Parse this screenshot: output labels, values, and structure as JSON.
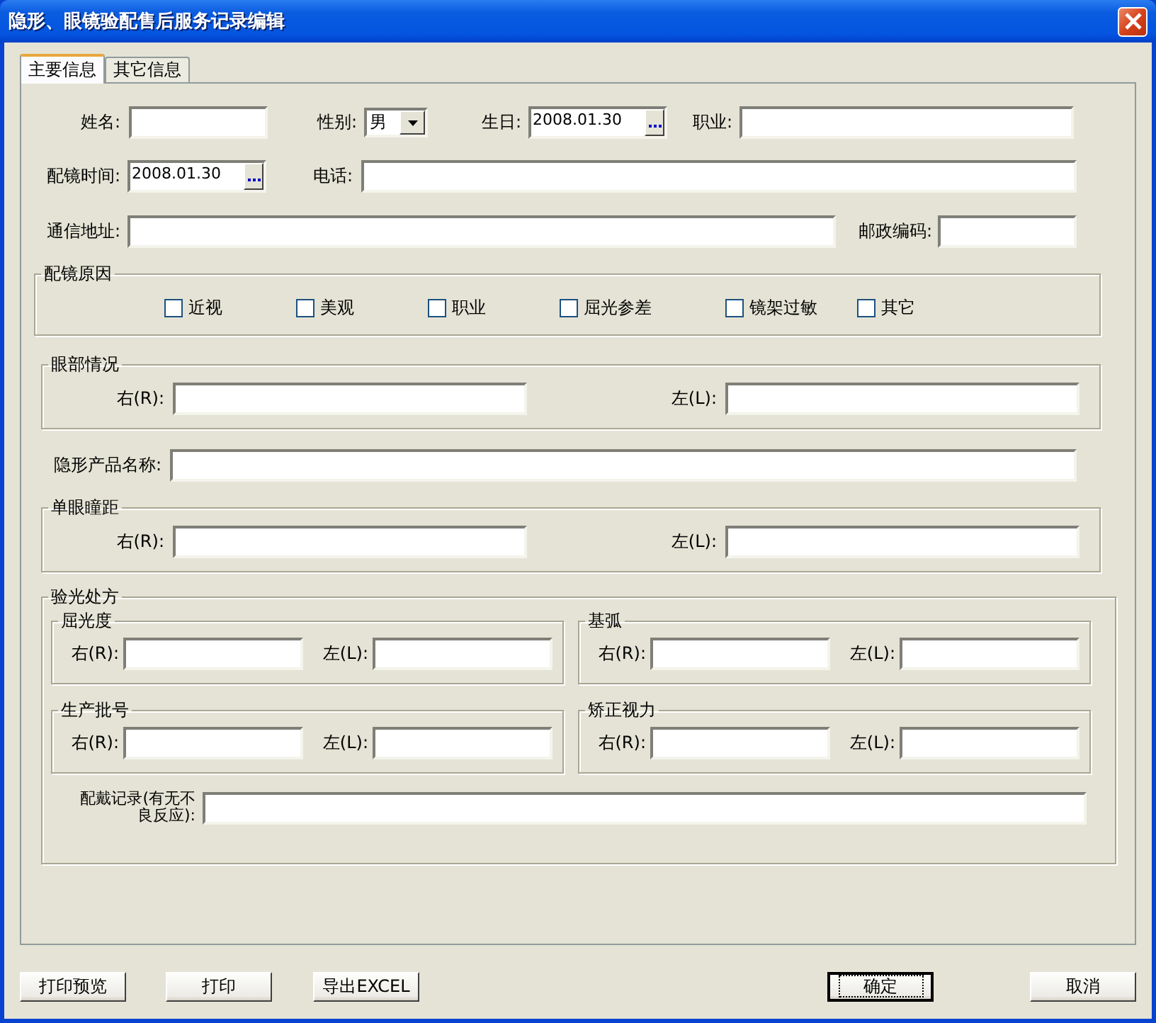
{
  "window": {
    "title": "隐形、眼镜验配售后服务记录编辑"
  },
  "tabs": [
    {
      "label": "主要信息",
      "selected": true
    },
    {
      "label": "其它信息",
      "selected": false
    }
  ],
  "basic": {
    "name": {
      "label": "姓名:"
    },
    "gender": {
      "label": "性别:",
      "value": "男"
    },
    "birthday": {
      "label": "生日:",
      "value": "2008.01.30"
    },
    "occupation": {
      "label": "职业:"
    },
    "fit_time": {
      "label": "配镜时间:",
      "value": "2008.01.30"
    },
    "phone": {
      "label": "电话:"
    },
    "address": {
      "label": "通信地址:"
    },
    "postcode": {
      "label": "邮政编码:"
    }
  },
  "reason": {
    "title": "配镜原因",
    "options": [
      {
        "label": "近视",
        "checked": false
      },
      {
        "label": "美观",
        "checked": false
      },
      {
        "label": "职业",
        "checked": false
      },
      {
        "label": "屈光参差",
        "checked": false
      },
      {
        "label": "镜架过敏",
        "checked": false
      },
      {
        "label": "其它",
        "checked": false
      }
    ]
  },
  "eye_condition": {
    "title": "眼部情况",
    "right": "右(R):",
    "left": "左(L):"
  },
  "product": {
    "label": "隐形产品名称:"
  },
  "pupil_distance": {
    "title": "单眼瞳距",
    "right": "右(R):",
    "left": "左(L):"
  },
  "prescription": {
    "title": "验光处方",
    "groups": [
      {
        "title": "屈光度",
        "right": "右(R):",
        "left": "左(L):"
      },
      {
        "title": "基弧",
        "right": "右(R):",
        "left": "左(L):"
      },
      {
        "title": "生产批号",
        "right": "右(R):",
        "left": "左(L):"
      },
      {
        "title": "矫正视力",
        "right": "右(R):",
        "left": "左(L):"
      }
    ],
    "record_label": "配戴记录(有无不良反应):"
  },
  "buttons": [
    {
      "label": "打印预览",
      "default": false
    },
    {
      "label": "打印",
      "default": false
    },
    {
      "label": "导出EXCEL",
      "default": false
    },
    {
      "label": "确定",
      "default": true
    },
    {
      "label": "取消",
      "default": false
    }
  ]
}
